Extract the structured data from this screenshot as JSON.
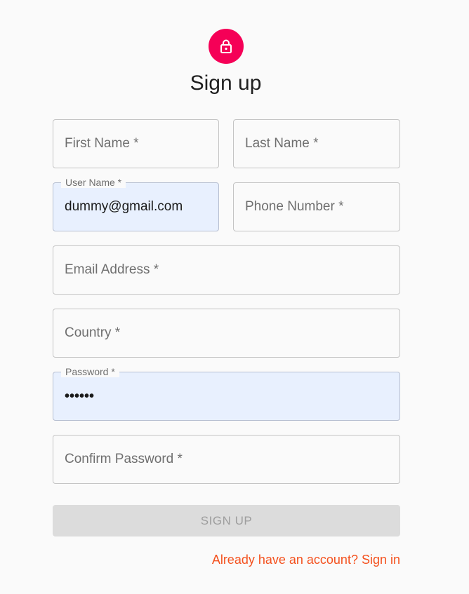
{
  "header": {
    "title": "Sign up"
  },
  "form": {
    "first_name": {
      "placeholder": "First Name *"
    },
    "last_name": {
      "placeholder": "Last Name *"
    },
    "user_name": {
      "label": "User Name *",
      "value": "dummy@gmail.com"
    },
    "phone_number": {
      "placeholder": "Phone Number *"
    },
    "email": {
      "placeholder": "Email Address *"
    },
    "country": {
      "placeholder": "Country *"
    },
    "password": {
      "label": "Password *",
      "value": "••••••"
    },
    "confirm_password": {
      "placeholder": "Confirm Password *"
    },
    "submit_label": "SIGN UP",
    "signin_link": "Already have an account? Sign in"
  },
  "colors": {
    "accent": "#f50057",
    "link": "#f4511e",
    "autofill_bg": "#e8f0fe",
    "button_disabled_bg": "#dcdcdc"
  },
  "icons": {
    "avatar": "lock-outline-icon"
  }
}
